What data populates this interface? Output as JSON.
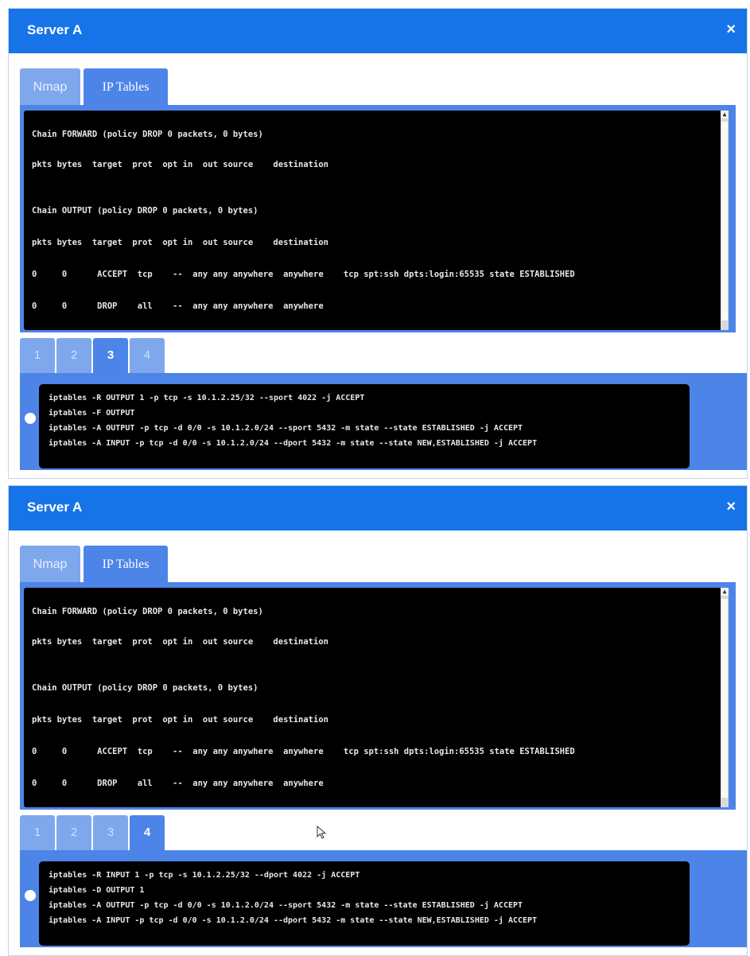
{
  "colors": {
    "titlebar": "#1674e8",
    "frame": "#4d84e8",
    "inactive_tab": "#7fa7ec",
    "terminal_bg": "#000000"
  },
  "icons": {
    "close": "close-icon",
    "cursor": "mouse-pointer-icon"
  },
  "panels": [
    {
      "title": "Server A",
      "close": "×",
      "tabs": [
        "Nmap",
        "IP Tables"
      ],
      "active_tab": "IP Tables",
      "terminal_lines": [
        "Chain FORWARD (policy DROP 0 packets, 0 bytes)",
        "pkts bytes  target  prot  opt in  out source    destination",
        "Chain OUTPUT (policy DROP 0 packets, 0 bytes)",
        "pkts bytes  target  prot  opt in  out source    destination",
        "0     0      ACCEPT  tcp    --  any any anywhere  anywhere    tcp spt:ssh dpts:login:65535 state ESTABLISHED",
        "0     0      DROP    all    --  any any anywhere  anywhere"
      ],
      "pages": [
        "1",
        "2",
        "3",
        "4"
      ],
      "active_page": "3",
      "answer_lines": [
        "iptables -R OUTPUT 1 -p tcp -s 10.1.2.25/32 --sport 4022 -j ACCEPT",
        "iptables -F OUTPUT",
        "iptables -A OUTPUT -p tcp -d 0/0 -s 10.1.2.0/24 --sport 5432 -m state --state ESTABLISHED -j ACCEPT",
        "iptables -A INPUT -p tcp -d 0/0 -s 10.1.2.0/24 --dport 5432 -m state --state NEW,ESTABLISHED -j ACCEPT"
      ]
    },
    {
      "title": "Server A",
      "close": "×",
      "tabs": [
        "Nmap",
        "IP Tables"
      ],
      "active_tab": "IP Tables",
      "terminal_lines": [
        "Chain FORWARD (policy DROP 0 packets, 0 bytes)",
        "pkts bytes  target  prot  opt in  out source    destination",
        "Chain OUTPUT (policy DROP 0 packets, 0 bytes)",
        "pkts bytes  target  prot  opt in  out source    destination",
        "0     0      ACCEPT  tcp    --  any any anywhere  anywhere    tcp spt:ssh dpts:login:65535 state ESTABLISHED",
        "0     0      DROP    all    --  any any anywhere  anywhere"
      ],
      "pages": [
        "1",
        "2",
        "3",
        "4"
      ],
      "active_page": "4",
      "answer_lines": [
        "iptables -R INPUT 1 -p tcp -s 10.1.2.25/32 --dport 4022 -j ACCEPT",
        "iptables -D OUTPUT 1",
        "iptables -A OUTPUT -p tcp -d 0/0 -s 10.1.2.0/24 --sport 5432 -m state --state ESTABLISHED -j ACCEPT",
        "iptables -A INPUT -p tcp -d 0/0 -s 10.1.2.0/24 --dport 5432 -m state --state NEW,ESTABLISHED -j ACCEPT"
      ]
    }
  ]
}
